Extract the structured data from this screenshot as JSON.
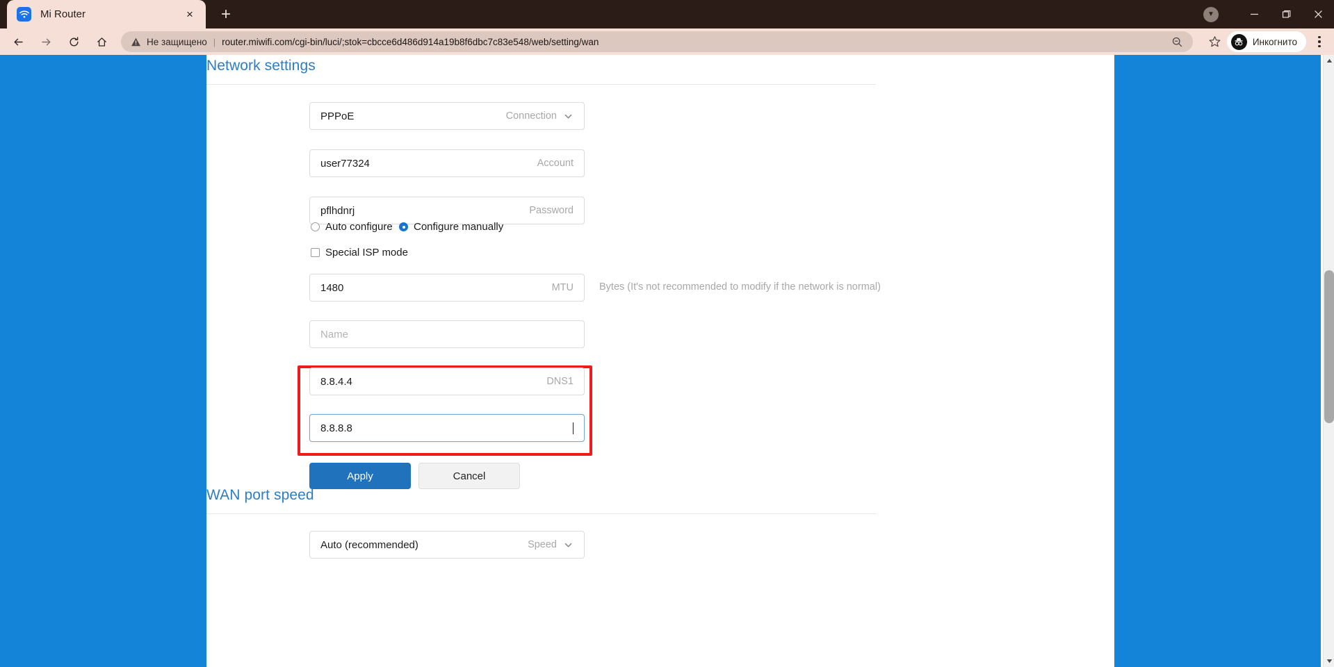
{
  "browser": {
    "tab": {
      "title": "Mi Router",
      "favicon": "wifi-icon",
      "close": "×"
    },
    "new_tab": "+",
    "window_controls": {
      "minimize": "—",
      "maximize": "❐",
      "close": "✕",
      "caret": "▼"
    },
    "nav": {
      "back": "←",
      "forward": "→",
      "reload": "↻",
      "home": "⌂"
    },
    "omnibox": {
      "security_icon": "warning-triangle-icon",
      "security_text": "Не защищено",
      "separator": "|",
      "url": "router.miwifi.com/cgi-bin/luci/;stok=cbcce6d486d914a19b8f6dbc7c83e548/web/setting/wan",
      "zoom_icon": "zoom-out-icon",
      "bookmark_icon": "star-icon"
    },
    "profile": {
      "label": "Инкогнито",
      "icon": "incognito-icon"
    },
    "menu_icon": "kebab-menu-icon"
  },
  "page": {
    "background_color": "#1484d8",
    "accent_color": "#2d7dc4",
    "highlight_color": "#ee1c1c",
    "sections": {
      "network": {
        "title": "Network settings",
        "fields": {
          "connection": {
            "value": "PPPoE",
            "label": "Connection",
            "chevron": "chevron-down-icon"
          },
          "account": {
            "value": "user77324",
            "label": "Account"
          },
          "password": {
            "value": "pflhdnrj",
            "label": "Password"
          },
          "mtu": {
            "value": "1480",
            "label": "MTU",
            "help": "Bytes (It's not recommended to modify if the network is normal)"
          },
          "name": {
            "value": "",
            "placeholder": "Name",
            "label": ""
          },
          "dns1": {
            "value": "8.8.4.4",
            "label": "DNS1"
          },
          "dns2": {
            "value": "8.8.8.8",
            "label": "",
            "focused": true
          }
        },
        "radios": [
          {
            "label": "Auto configure",
            "checked": false
          },
          {
            "label": "Configure manually",
            "checked": true
          }
        ],
        "checkbox": {
          "label": "Special ISP mode",
          "checked": false
        },
        "buttons": {
          "apply": "Apply",
          "cancel": "Cancel"
        }
      },
      "wan_speed": {
        "title": "WAN port speed",
        "speed": {
          "value": "Auto (recommended)",
          "label": "Speed",
          "chevron": "chevron-down-icon"
        }
      }
    }
  }
}
